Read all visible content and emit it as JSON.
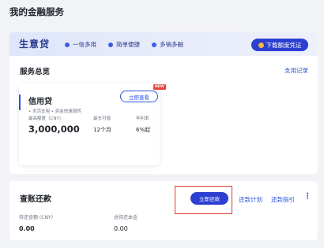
{
  "page_title": "我的金融服务",
  "banner": {
    "brand": "生意贷",
    "features": [
      "一信多用",
      "简单便捷",
      "多销多融"
    ],
    "download_label": "下载额度凭证"
  },
  "overview": {
    "title": "服务总览",
    "records_link": "支用记录"
  },
  "credit": {
    "title": "信用贷",
    "tags": "• 灵活支用  • 资金快速周转",
    "apply_label": "立即查看",
    "new_badge": "NEW",
    "max_label": "最高额度（CNY）",
    "max_value": "3,000,000",
    "term_label": "最长可借",
    "term_value": "12个月",
    "rate_label": "年利率",
    "rate_value": "6%起"
  },
  "repay": {
    "title": "查账还款",
    "repay_label": "立即还款",
    "plan_link": "还款计划",
    "guide_link": "还款指引",
    "more_icon": "more-vertical-icon",
    "due_label": "待还金额 (CNY)",
    "due_value": "0.00",
    "principal_label": "总待还本金",
    "principal_value": "0.00"
  },
  "colors": {
    "accent": "#2b3fd1",
    "link": "#2b55e0",
    "highlight": "#e03a2f",
    "badge": "#e8453c"
  }
}
